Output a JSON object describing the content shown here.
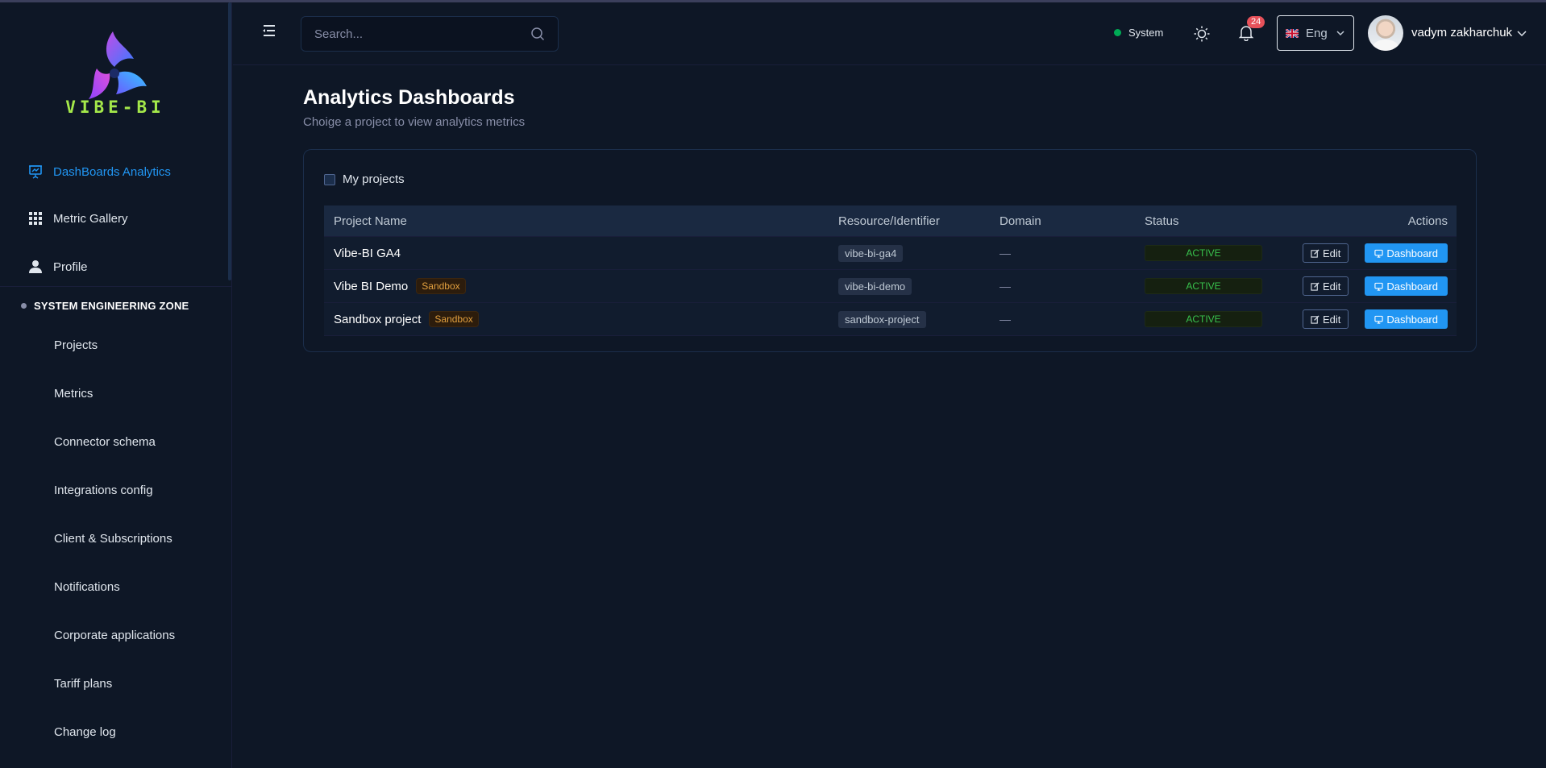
{
  "brand": {
    "logo_text": "VIBE-BI",
    "accent": "#2196f3"
  },
  "sidebar": {
    "items": [
      {
        "label": "DashBoards Analytics",
        "icon": "presentation-board-icon",
        "active": true
      },
      {
        "label": "Metric Gallery",
        "icon": "grid-icon",
        "active": false
      },
      {
        "label": "Profile",
        "icon": "user-icon",
        "active": false
      }
    ],
    "section_title": "SYSTEM ENGINEERING ZONE",
    "section_items": [
      "Projects",
      "Metrics",
      "Connector schema",
      "Integrations config",
      "Client & Subscriptions",
      "Notifications",
      "Corporate applications",
      "Tariff plans",
      "Change log"
    ]
  },
  "header": {
    "search_placeholder": "Search...",
    "system_label": "System",
    "notification_count": "24",
    "language": "Eng",
    "user_name": "vadym zakharchuk"
  },
  "main": {
    "title": "Analytics Dashboards",
    "subtitle": "Choige a project to view analytics metrics",
    "filter_label": "My projects",
    "table": {
      "headers": [
        "Project Name",
        "Resource/Identifier",
        "Domain",
        "Status",
        "Actions"
      ],
      "rows": [
        {
          "name": "Vibe-BI GA4",
          "tag": "",
          "identifier": "vibe-bi-ga4",
          "domain": "—",
          "status": "ACTIVE"
        },
        {
          "name": "Vibe BI Demo",
          "tag": "Sandbox",
          "identifier": "vibe-bi-demo",
          "domain": "—",
          "status": "ACTIVE"
        },
        {
          "name": "Sandbox project",
          "tag": "Sandbox",
          "identifier": "sandbox-project",
          "domain": "—",
          "status": "ACTIVE"
        }
      ],
      "edit_label": "Edit",
      "dashboard_label": "Dashboard"
    }
  }
}
